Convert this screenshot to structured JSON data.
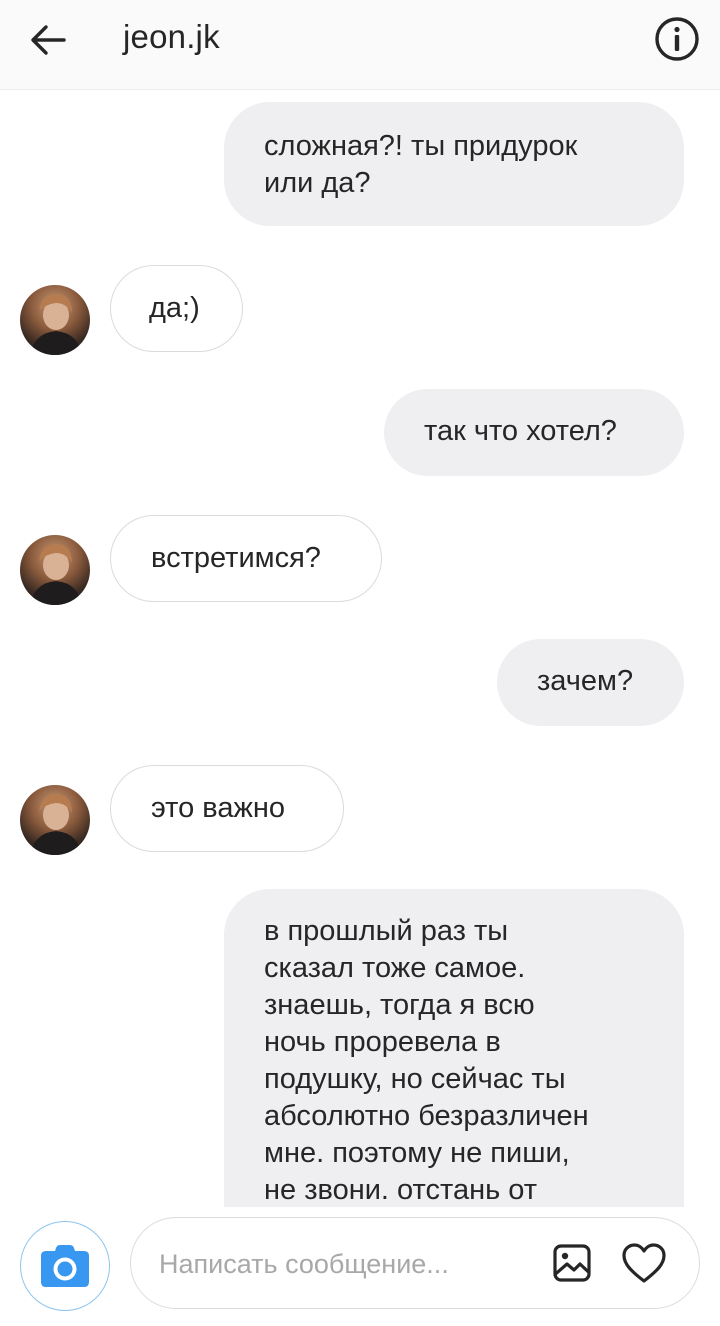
{
  "header": {
    "title": "jeon.jk",
    "back_icon": "arrow-left-icon",
    "info_icon": "info-icon"
  },
  "messages": [
    {
      "direction": "outgoing",
      "text": "сложная?! ты придурок\nили да?"
    },
    {
      "direction": "incoming",
      "text": "да;)"
    },
    {
      "direction": "outgoing",
      "text": "так что хотел?"
    },
    {
      "direction": "incoming",
      "text": "встретимся?"
    },
    {
      "direction": "outgoing",
      "text": "зачем?"
    },
    {
      "direction": "incoming",
      "text": "это важно"
    },
    {
      "direction": "outgoing",
      "text": "в прошлый раз ты\nсказал тоже самое.\nзнаешь, тогда я всю\nночь проревела в\nподушку, но сейчас ты\nабсолютно безразличен\nмне. поэтому не пиши,\nне звони. отстань от"
    }
  ],
  "composer": {
    "placeholder": "Написать сообщение...",
    "camera_icon": "camera-icon",
    "gallery_icon": "image-icon",
    "heart_icon": "heart-icon"
  },
  "colors": {
    "outgoing_bubble": "#efeef1",
    "incoming_border": "#dbdbdb",
    "camera_accent": "#3897f0"
  }
}
